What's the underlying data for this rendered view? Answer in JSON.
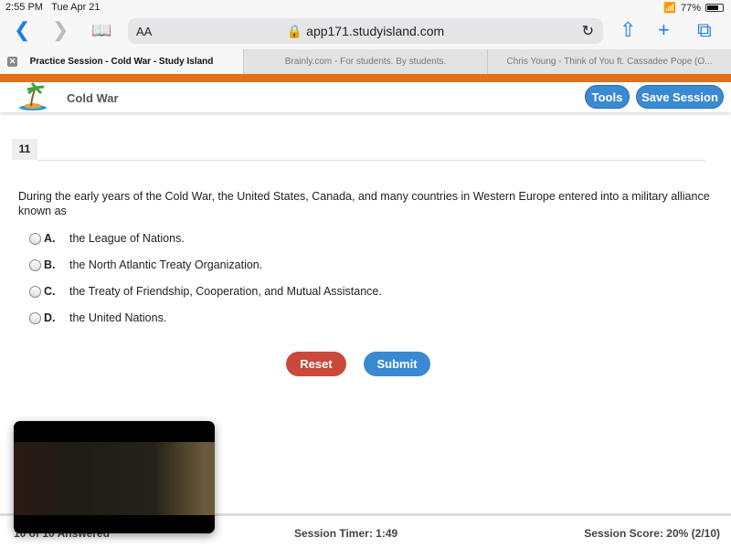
{
  "status_bar": {
    "time": "2:55 PM",
    "date": "Tue Apr 21",
    "battery": "77%",
    "battery_level": 0.77
  },
  "browser": {
    "text_size": "AA",
    "url": "app171.studyisland.com",
    "tabs": [
      {
        "label": "Practice Session - Cold War - Study Island",
        "active": true
      },
      {
        "label": "Brainly.com - For students. By students."
      },
      {
        "label": "Chris Young - Think of You ft. Cassadee Pope (O..."
      }
    ]
  },
  "header": {
    "title": "Cold War",
    "tools_label": "Tools",
    "save_label": "Save Session",
    "accent": "#e2701c"
  },
  "question": {
    "number": "11",
    "text": "During the early years of the Cold War, the United States, Canada, and many countries in Western Europe entered into a military alliance known as",
    "choices": [
      {
        "letter": "A.",
        "text": "the League of Nations."
      },
      {
        "letter": "B.",
        "text": "the North Atlantic Treaty Organization."
      },
      {
        "letter": "C.",
        "text": "the Treaty of Friendship, Cooperation, and Mutual Assistance."
      },
      {
        "letter": "D.",
        "text": "the United Nations."
      }
    ]
  },
  "actions": {
    "reset_label": "Reset",
    "submit_label": "Submit"
  },
  "footer": {
    "answered": "10 of 10 Answered",
    "timer": "Session Timer: 1:49",
    "score": "Session Score: 20% (2/10)"
  }
}
